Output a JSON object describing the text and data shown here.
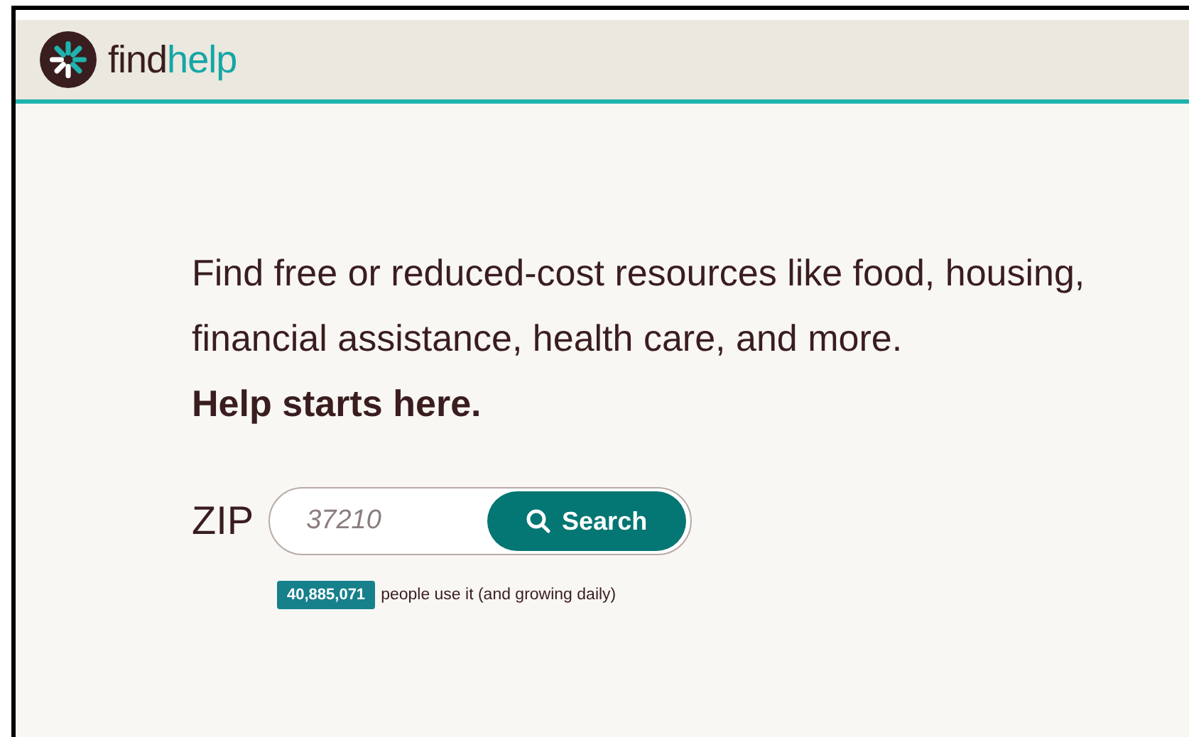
{
  "header": {
    "logo_primary": "find",
    "logo_accent": "help"
  },
  "intro": "Find free or reduced-cost resources like food, housing, financial assistance, health care, and more.",
  "tagline": "Help starts here.",
  "search": {
    "label": "ZIP",
    "placeholder": "37210",
    "button": "Search"
  },
  "stats": {
    "count": "40,885,071",
    "caption": "people use it (and growing daily)"
  }
}
